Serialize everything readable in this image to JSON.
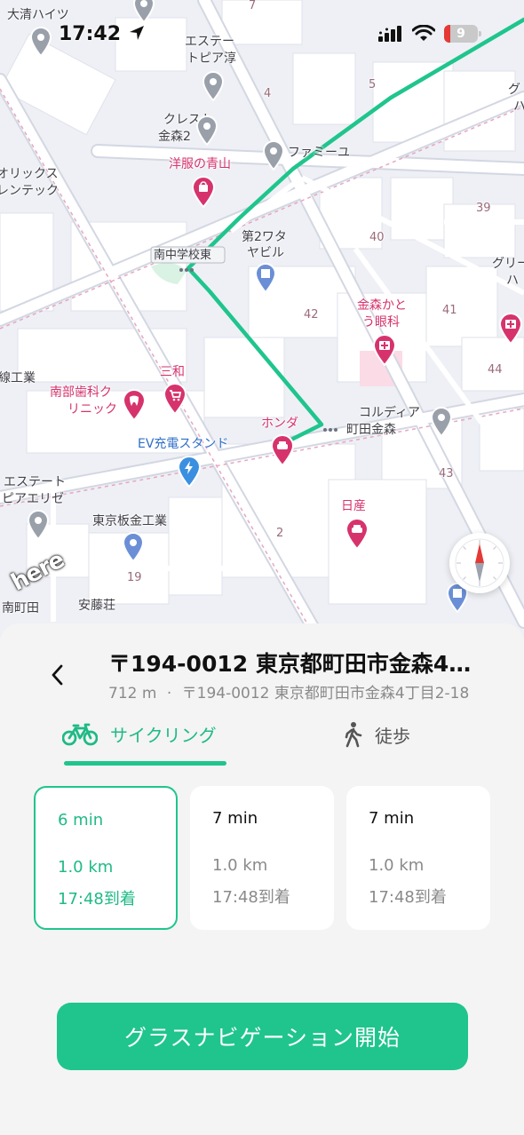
{
  "status_bar": {
    "time": "17:42",
    "battery": "9"
  },
  "map": {
    "labels": [
      {
        "text": "大清ハイツ",
        "style": ""
      },
      {
        "text": "エステー",
        "style": ""
      },
      {
        "text": "トピア淳",
        "style": ""
      },
      {
        "text": "クレスト",
        "style": ""
      },
      {
        "text": "金森2",
        "style": ""
      },
      {
        "text": "ファミーユ",
        "style": ""
      },
      {
        "text": "洋服の青山",
        "style": "poi-red"
      },
      {
        "text": "オリックス",
        "style": ""
      },
      {
        "text": "レンテック",
        "style": ""
      },
      {
        "text": "第2ワタ",
        "style": ""
      },
      {
        "text": "ヤビル",
        "style": ""
      },
      {
        "text": "南中学校東",
        "style": ""
      },
      {
        "text": "金森かと",
        "style": "poi-red"
      },
      {
        "text": "う眼科",
        "style": "poi-red"
      },
      {
        "text": "グリー",
        "style": ""
      },
      {
        "text": "ハ",
        "style": ""
      },
      {
        "text": "グ",
        "style": ""
      },
      {
        "text": "ハ",
        "style": ""
      },
      {
        "text": "線工業",
        "style": ""
      },
      {
        "text": "三和",
        "style": "poi-red"
      },
      {
        "text": "南部歯科ク",
        "style": "poi-red"
      },
      {
        "text": "リニック",
        "style": "poi-red"
      },
      {
        "text": "ホンダ",
        "style": "poi-red"
      },
      {
        "text": "コルディア",
        "style": ""
      },
      {
        "text": "町田金森",
        "style": ""
      },
      {
        "text": "EV充電スタンド",
        "style": "poi-blue"
      },
      {
        "text": "エステート",
        "style": ""
      },
      {
        "text": "ピアエリゼ",
        "style": ""
      },
      {
        "text": "東京板金工業",
        "style": ""
      },
      {
        "text": "日産",
        "style": "poi-red"
      },
      {
        "text": "安藤荘",
        "style": ""
      },
      {
        "text": "南町田",
        "style": ""
      },
      {
        "text": "7",
        "style": "num"
      },
      {
        "text": "4",
        "style": "num"
      },
      {
        "text": "5",
        "style": "num"
      },
      {
        "text": "40",
        "style": "num"
      },
      {
        "text": "39",
        "style": "num"
      },
      {
        "text": "42",
        "style": "num"
      },
      {
        "text": "41",
        "style": "num"
      },
      {
        "text": "44",
        "style": "num"
      },
      {
        "text": "43",
        "style": "num"
      },
      {
        "text": "2",
        "style": "num"
      },
      {
        "text": "19",
        "style": "num"
      }
    ],
    "pins": [
      {
        "icon": "map-pin-gray-icon",
        "color": "#9aa0aa"
      },
      {
        "icon": "map-pin-gray-icon",
        "color": "#9aa0aa"
      },
      {
        "icon": "map-pin-gray-icon",
        "color": "#9aa0aa"
      },
      {
        "icon": "map-pin-gray-icon",
        "color": "#9aa0aa"
      },
      {
        "icon": "map-pin-gray-icon",
        "color": "#9aa0aa"
      },
      {
        "icon": "shopping-bag-pin-icon",
        "color": "#d6336c"
      },
      {
        "icon": "building-pin-icon",
        "color": "#6b8fd6"
      },
      {
        "icon": "hospital-pin-icon",
        "color": "#d6336c"
      },
      {
        "icon": "hospital-pin-icon",
        "color": "#d6336c"
      },
      {
        "icon": "tooth-pin-icon",
        "color": "#d6336c"
      },
      {
        "icon": "cart-pin-icon",
        "color": "#d6336c"
      },
      {
        "icon": "car-pin-icon",
        "color": "#d6336c"
      },
      {
        "icon": "map-pin-gray-icon",
        "color": "#9aa0aa"
      },
      {
        "icon": "ev-charging-pin-icon",
        "color": "#3b8fe0"
      },
      {
        "icon": "map-pin-gray-icon",
        "color": "#9aa0aa"
      },
      {
        "icon": "building-pin-icon",
        "color": "#6b8fd6"
      },
      {
        "icon": "car-pin-icon",
        "color": "#d6336c"
      },
      {
        "icon": "building-pin-icon",
        "color": "#6b8fd6"
      }
    ],
    "route_color": "#1fc58c",
    "logo": "here"
  },
  "destination": {
    "title": "〒194-0012 東京都町田市金森4…",
    "distance": "712 m",
    "separator": "·",
    "address": "〒194-0012 東京都町田市金森4丁目2-18"
  },
  "tabs": [
    {
      "label": "サイクリング",
      "icon": "bicycle-icon",
      "selected": true
    },
    {
      "label": "徒歩",
      "icon": "walking-icon",
      "selected": false
    }
  ],
  "routes": [
    {
      "time": "6 min",
      "distance": "1.0 km",
      "arrival": "17:48到着",
      "selected": true
    },
    {
      "time": "7 min",
      "distance": "1.0 km",
      "arrival": "17:48到着",
      "selected": false
    },
    {
      "time": "7 min",
      "distance": "1.0 km",
      "arrival": "17:48到着",
      "selected": false
    }
  ],
  "start_button": {
    "label": "グラスナビゲーション開始"
  },
  "colors": {
    "accent": "#1fc58c",
    "accent_text": "#1fba86",
    "poi": "#d6336c"
  }
}
